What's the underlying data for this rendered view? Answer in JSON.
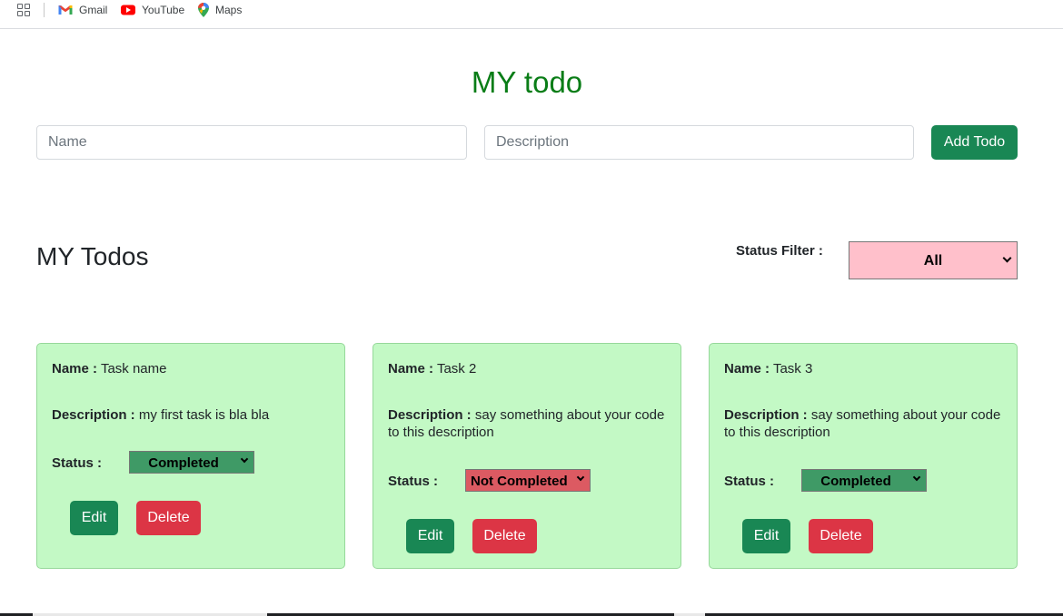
{
  "bookmarks": {
    "items": [
      {
        "label": "Gmail",
        "icon": "gmail-icon"
      },
      {
        "label": "YouTube",
        "icon": "youtube-icon"
      },
      {
        "label": "Maps",
        "icon": "maps-icon"
      }
    ]
  },
  "header": {
    "title": "MY todo",
    "name_placeholder": "Name",
    "description_placeholder": "Description",
    "add_button": "Add Todo"
  },
  "list": {
    "title": "MY Todos",
    "filter_label": "Status Filter :",
    "filter_value": "All"
  },
  "labels": {
    "name": "Name :",
    "description": "Description :",
    "status": "Status :",
    "edit": "Edit",
    "delete": "Delete"
  },
  "todos": [
    {
      "name": "Task name",
      "description": "my first task is bla bla",
      "status": "Completed"
    },
    {
      "name": "Task 2",
      "description": "say something about your code to this description",
      "status": "Not Completed"
    },
    {
      "name": "Task 3",
      "description": "say something about your code to this description",
      "status": "Completed"
    }
  ],
  "colors": {
    "title_green": "#0a7d17",
    "button_success": "#198754",
    "button_danger": "#dc3545",
    "card_background": "#c3f9c5",
    "filter_background": "#ffc0cb",
    "status_completed": "#3f9a66",
    "status_not_completed": "#dc5a62"
  }
}
